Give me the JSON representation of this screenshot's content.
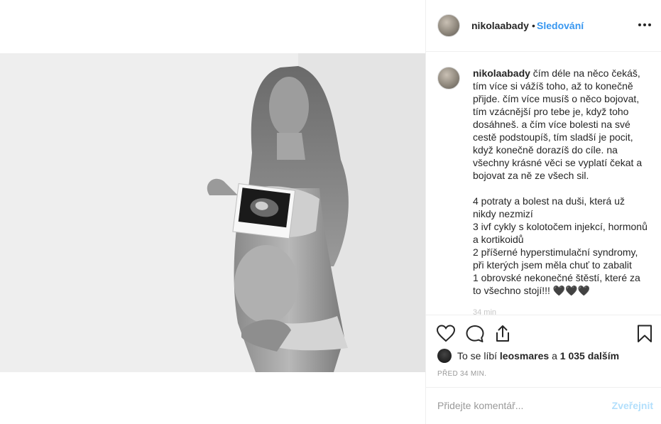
{
  "post": {
    "username": "nikolaabady",
    "separator": "•",
    "follow_label": "Sledování",
    "caption_username": "nikolaabady",
    "caption_text": " čím déle na něco čekáš, tím více si vážíš toho, až to konečně přijde. čím více musíš o něco bojovat, tím vzácnější pro tebe je, když toho dosáhneš. a čím více bolesti na své cestě podstoupíš, tím sladší je pocit, když konečně dorazíš do cíle. na všechny krásné věci se vyplatí čekat a bojovat za ně ze všech sil.\n\n4 potraty a bolest na duši, která už nikdy nezmizí\n3 ivf cykly s kolotočem injekcí, hormonů a kortikoidů\n2 příšerné hyperstimulační syndromy, při kterých jsem měla chuť to zabalit\n1 obrovské nekonečné štěstí, které za to všechno stojí!!! 🖤🖤🖤",
    "caption_overflow": "34 min"
  },
  "likes": {
    "prefix": "To se líbí ",
    "user": "leosmares",
    "middle": " a ",
    "count": "1 035 dalším"
  },
  "timestamp": "PŘED 34 MIN.",
  "comment": {
    "placeholder": "Přidejte komentář...",
    "post_label": "Zveřejnit"
  },
  "icons": {
    "like": "heart-icon",
    "comment": "comment-icon",
    "share": "share-icon",
    "save": "bookmark-icon",
    "more": "more-icon"
  },
  "colors": {
    "accent": "#3897f0",
    "post_disabled": "#b2dffc",
    "text": "#262626",
    "muted": "#999999"
  }
}
